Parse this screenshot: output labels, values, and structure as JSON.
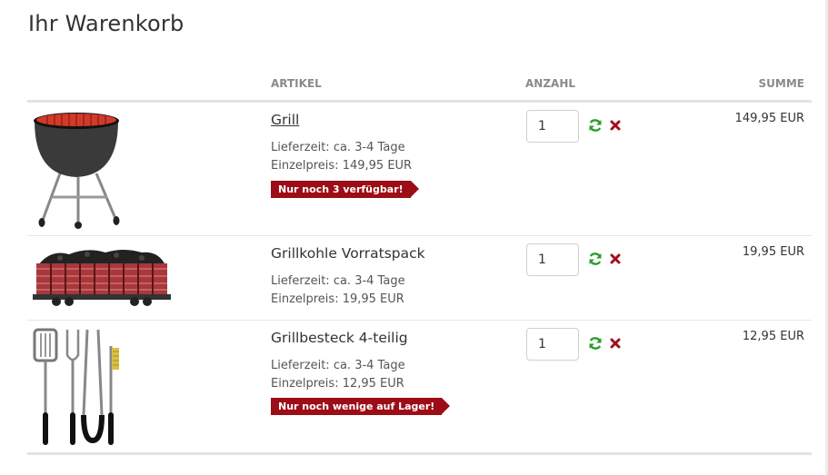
{
  "page": {
    "title": "Ihr Warenkorb"
  },
  "columns": {
    "article": "ARTIKEL",
    "quantity": "ANZAHL",
    "sum": "SUMME"
  },
  "colors": {
    "badge": "#9c0d17",
    "refresh": "#2a9d2a",
    "remove": "#a0101a"
  },
  "items": [
    {
      "name": "Grill",
      "delivery": "Lieferzeit: ca. 3-4 Tage",
      "unit_price": "Einzelpreis: 149,95 EUR",
      "badge": "Nur noch 3 verfügbar!",
      "quantity": "1",
      "sum": "149,95 EUR",
      "image": "grill-icon"
    },
    {
      "name": "Grillkohle Vorratspack",
      "delivery": "Lieferzeit: ca. 3-4 Tage",
      "unit_price": "Einzelpreis: 19,95 EUR",
      "quantity": "1",
      "sum": "19,95 EUR",
      "image": "coal-wagon-icon"
    },
    {
      "name": "Grillbesteck 4-teilig",
      "delivery": "Lieferzeit: ca. 3-4 Tage",
      "unit_price": "Einzelpreis: 12,95 EUR",
      "badge": "Nur noch wenige auf Lager!",
      "quantity": "1",
      "sum": "12,95 EUR",
      "image": "bbq-tools-icon"
    }
  ]
}
